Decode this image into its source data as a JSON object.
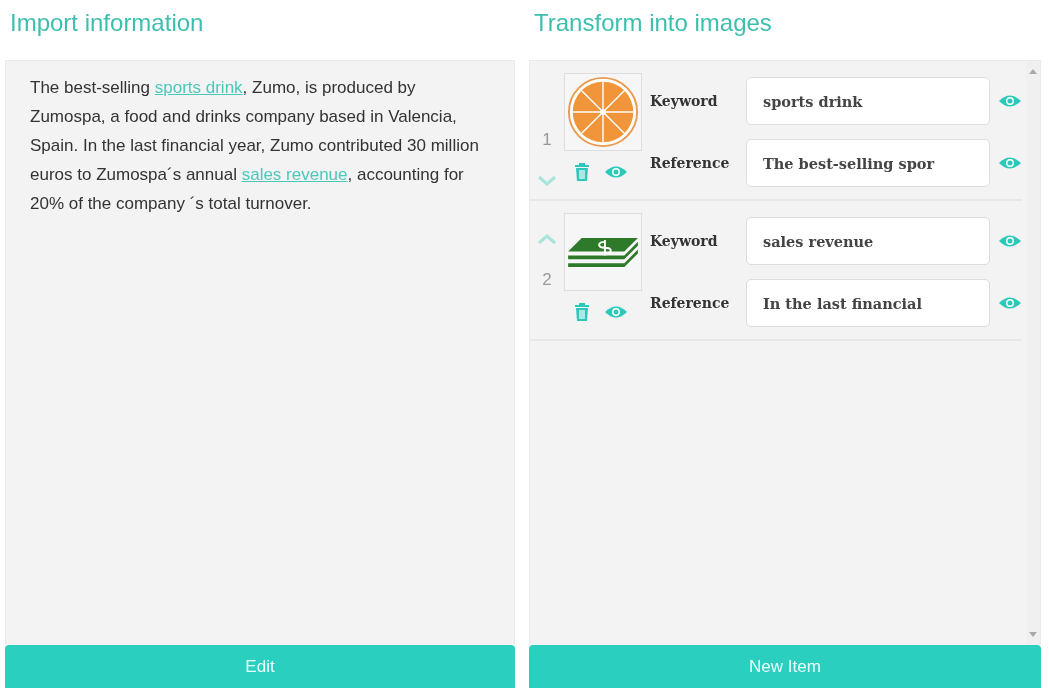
{
  "import_panel": {
    "title": "Import information",
    "paragraph": [
      {
        "text": "The best-selling ",
        "link": false
      },
      {
        "text": "sports drink",
        "link": true
      },
      {
        "text": ", Zumo, is produced by Zumospa, a food and drinks company based in Valencia, Spain. In the last financial year, Zumo contributed 30 million euros to Zumospa´s annual ",
        "link": false
      },
      {
        "text": "sales revenue",
        "link": true
      },
      {
        "text": ", accounting for 20% of the company ´s total turnover.",
        "link": false
      }
    ],
    "button": "Edit"
  },
  "transform_panel": {
    "title": "Transform into images",
    "items": [
      {
        "number": "1",
        "can_move_up": false,
        "can_move_down": true,
        "keyword_label": "Keyword",
        "keyword": "sports drink",
        "reference_label": "Reference",
        "reference": "The best-selling spor"
      },
      {
        "number": "2",
        "can_move_up": true,
        "can_move_down": false,
        "keyword_label": "Keyword",
        "keyword": "sales revenue",
        "reference_label": "Reference",
        "reference": "In the last financial"
      }
    ],
    "button": "New Item"
  }
}
